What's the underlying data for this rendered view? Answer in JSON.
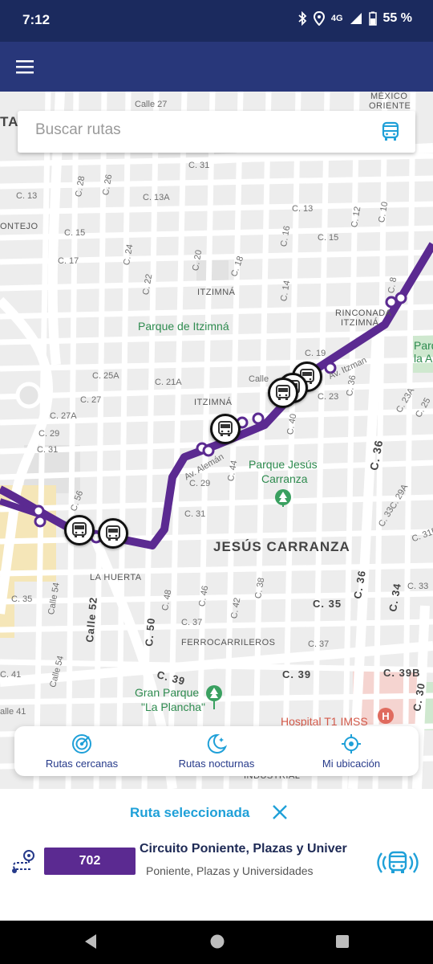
{
  "status_bar": {
    "time": "7:12",
    "network": "4G",
    "battery": "55 %",
    "icons": [
      "bluetooth-icon",
      "location-icon",
      "signal-icon",
      "battery-icon"
    ]
  },
  "app_bar": {
    "menu_icon": "hamburger-menu-icon"
  },
  "search": {
    "placeholder": "Buscar rutas",
    "value": "",
    "icon": "bus-icon"
  },
  "map": {
    "labels": {
      "calle_27": "Calle 27",
      "mexico": "MÉXICO",
      "oriente": "ORIENTE",
      "ta": "TA",
      "c31_top": "C. 31",
      "c13_left": "C. 13",
      "ontejo": "ONTEJO",
      "c15_left": "C. 15",
      "c17": "C. 17",
      "c28": "C. 28",
      "c26": "C. 26",
      "c13a": "C. 13A",
      "c24": "C. 24",
      "c22": "C. 22",
      "c20": "C. 20",
      "c18": "C. 18",
      "c13_right": "C. 13",
      "c12": "C. 12",
      "c10": "C. 10",
      "c16": "C. 16",
      "c15_right": "C. 15",
      "c14": "C. 14",
      "c8": "C. 8",
      "itzimna_top": "ITZIMNÁ",
      "rinconada": "RINCONADA",
      "itzimna_rinc": "ITZIMNÁ",
      "parque_itzimna": "Parque de Itzimná",
      "parque_a": "Parq",
      "parque_a2": "la A",
      "c19": "C. 19",
      "av_itzaes": "Av. Itzman",
      "c25a": "C. 25A",
      "c21a": "C. 21A",
      "c27": "C. 27",
      "calle_top": "Calle",
      "c23": "C. 23",
      "c36_small": "C. 36",
      "c23a": "C. 23A",
      "c25": "C. 25",
      "c27a": "C. 27A",
      "itzimna_mid": "ITZIMNÁ",
      "c40": "C. 40",
      "c29_left": "C. 29",
      "c31_left": "C. 31",
      "av_alemán": "Av. Alemán",
      "c36_big": "C. 36",
      "c44": "C. 44",
      "c29_mid": "C. 29",
      "parque_jesus": "Parque Jesús",
      "carranza": "Carranza",
      "c29a": "C. 29A",
      "c56": "C. 56",
      "c31_mid": "C. 31",
      "c33": "C. 33",
      "c31b": "C. 31D",
      "jesus_carranza": "JESÚS CARRANZA",
      "la_huerta": "LA HUERTA",
      "calle_54": "Calle 54",
      "calle_52": "Calle 52",
      "c50": "C. 50",
      "c48": "C. 48",
      "c46": "C. 46",
      "c42": "C. 42",
      "c38": "C. 38",
      "c36_lower": "C. 36",
      "c34": "C. 34",
      "c35_left": "C. 35",
      "c35_right": "C. 35",
      "c33_right": "C. 33",
      "c37_mid": "C. 37",
      "c37_right": "C. 37",
      "ferrocarrileros": "FERROCARRILEROS",
      "c39_left": "C. 39",
      "c39_right": "C. 39",
      "c39b": "C. 39B",
      "c30": "C. 30",
      "calle_54b": "Calle 54",
      "calle_41": "alle 41",
      "c41": "C. 41",
      "gran_parque": "Gran Parque",
      "la_plancha": "\"La Plancha\"",
      "hospital": "Hospital T1 IMSS",
      "industrial": "INDUSTRIAL"
    },
    "route_color": "#5b2a91"
  },
  "quick_actions": [
    {
      "label": "Rutas cercanas",
      "icon": "radar-icon"
    },
    {
      "label": "Rutas nocturnas",
      "icon": "moon-stars-icon"
    },
    {
      "label": "Mi ubicación",
      "icon": "crosshair-icon"
    }
  ],
  "selected_route": {
    "title": "Ruta seleccionada",
    "number": "702",
    "name": "Circuito Poniente, Plazas y Univer",
    "description": "Poniente, Plazas y Universidades",
    "accent": "#1fa0d8",
    "badge_color": "#5b2a91"
  },
  "nav_bar": {
    "back": "back-icon",
    "home": "home-icon",
    "recents": "recents-icon"
  }
}
